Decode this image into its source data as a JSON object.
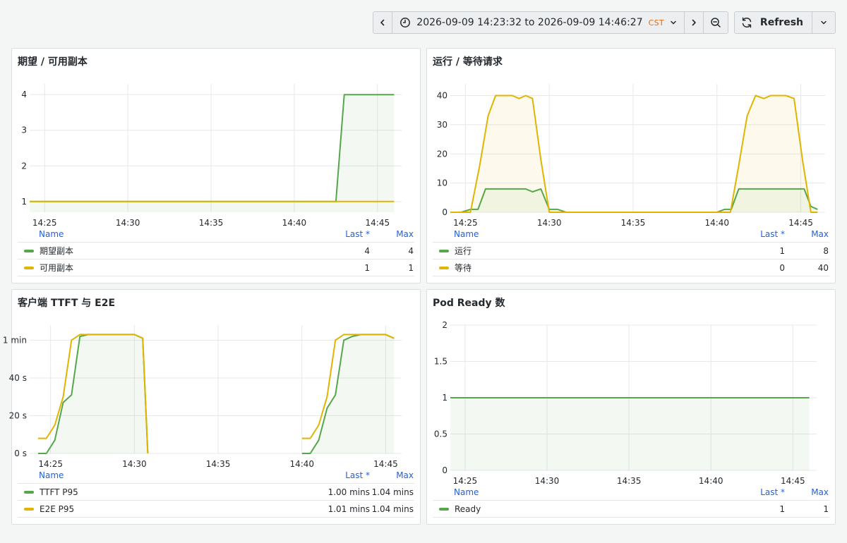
{
  "toolbar": {
    "time_range": "2026-09-09 14:23:32 to 2026-09-09 14:46:27",
    "timezone": "CST",
    "refresh_label": "Refresh"
  },
  "colors": {
    "green": "#56a64b",
    "yellow": "#e0b400",
    "green_fill": "rgba(86,166,75,0.08)",
    "yellow_fill": "rgba(224,180,0,0.08)"
  },
  "legend_header": {
    "name": "Name",
    "last": "Last *",
    "max": "Max"
  },
  "panels": [
    {
      "title": "期望 / 可用副本",
      "legend": [
        {
          "name": "期望副本",
          "last": "4",
          "max": "4",
          "color": "#56a64b"
        },
        {
          "name": "可用副本",
          "last": "1",
          "max": "1",
          "color": "#e0b400"
        }
      ]
    },
    {
      "title": "运行 / 等待请求",
      "legend": [
        {
          "name": "运行",
          "last": "1",
          "max": "8",
          "color": "#56a64b"
        },
        {
          "name": "等待",
          "last": "0",
          "max": "40",
          "color": "#e0b400"
        }
      ]
    },
    {
      "title": "客户端 TTFT 与 E2E",
      "legend": [
        {
          "name": "TTFT P95",
          "last": "1.00 mins",
          "max": "1.04 mins",
          "color": "#56a64b"
        },
        {
          "name": "E2E P95",
          "last": "1.01 mins",
          "max": "1.04 mins",
          "color": "#e0b400"
        }
      ]
    },
    {
      "title": "Pod Ready 数",
      "legend": [
        {
          "name": "Ready",
          "last": "1",
          "max": "1",
          "color": "#56a64b"
        }
      ]
    }
  ],
  "chart_data": [
    {
      "type": "line",
      "title": "期望 / 可用副本",
      "x_ticks": [
        "14:25",
        "14:30",
        "14:35",
        "14:40",
        "14:45"
      ],
      "y_ticks": [
        "1",
        "2",
        "3",
        "4"
      ],
      "ylim": [
        0.7,
        4.3
      ],
      "xlim": [
        24.1,
        46.45
      ],
      "grid": true,
      "fill_series": 0,
      "series": [
        {
          "name": "期望副本",
          "color": "#56a64b",
          "x": [
            24.1,
            42.5,
            43.0,
            46.0
          ],
          "y": [
            1,
            1,
            4,
            4
          ]
        },
        {
          "name": "可用副本",
          "color": "#e0b400",
          "x": [
            24.1,
            46.0
          ],
          "y": [
            1,
            1
          ]
        }
      ]
    },
    {
      "type": "line",
      "title": "运行 / 等待请求",
      "x_ticks": [
        "14:25",
        "14:30",
        "14:35",
        "14:40",
        "14:45"
      ],
      "y_ticks": [
        "0",
        "10",
        "20",
        "30",
        "40"
      ],
      "ylim": [
        0,
        44
      ],
      "xlim": [
        24.1,
        46.45
      ],
      "grid": true,
      "fill_series": "all",
      "series": [
        {
          "name": "运行",
          "color": "#56a64b",
          "x": [
            24.1,
            24.75,
            25.3,
            25.75,
            26.2,
            26.7,
            27.2,
            27.7,
            28.1,
            28.6,
            29.0,
            29.5,
            30.0,
            30.5,
            31.0,
            40.0,
            40.45,
            40.85,
            41.3,
            45.2,
            45.6,
            46.0
          ],
          "y": [
            0,
            0,
            1,
            1,
            8,
            8,
            8,
            8,
            8,
            8,
            7,
            8,
            1,
            1,
            0,
            0,
            1,
            1,
            8,
            8,
            2,
            1
          ]
        },
        {
          "name": "等待",
          "color": "#e0b400",
          "x": [
            24.1,
            25.3,
            25.85,
            26.35,
            26.8,
            27.3,
            27.8,
            28.2,
            28.6,
            29.0,
            29.5,
            30.0,
            31.0,
            40.0,
            40.8,
            41.3,
            41.8,
            42.3,
            42.8,
            43.2,
            43.6,
            44.1,
            44.6,
            45.1,
            45.6,
            46.0
          ],
          "y": [
            0,
            0,
            16,
            33,
            40,
            40,
            40,
            39,
            40,
            39,
            18,
            0,
            0,
            0,
            0,
            16,
            33,
            40,
            39,
            40,
            40,
            40,
            39,
            18,
            0,
            0
          ]
        }
      ]
    },
    {
      "type": "line",
      "title": "客户端 TTFT 与 E2E",
      "x_ticks": [
        "14:25",
        "14:30",
        "14:35",
        "14:40",
        "14:45"
      ],
      "y_ticks": [
        "0 s",
        "20 s",
        "40 s",
        "1 min"
      ],
      "ylim": [
        0,
        68
      ],
      "xlim": [
        23.75,
        45.95
      ],
      "grid": true,
      "fill_series": 0,
      "series": [
        {
          "name": "TTFT P95",
          "color": "#56a64b",
          "x": [
            24.25,
            24.75,
            25.25,
            25.75,
            26.25,
            26.75,
            27.25,
            27.75,
            28.25,
            28.75,
            29.25,
            30.0,
            30.5,
            30.8
          ],
          "y": [
            0,
            0,
            7,
            27,
            31,
            62,
            63,
            63,
            63,
            63,
            63,
            63,
            61,
            0
          ]
        },
        {
          "name": "E2E P95",
          "color": "#e0b400",
          "x": [
            24.25,
            24.75,
            25.25,
            25.75,
            26.25,
            26.75,
            27.25,
            27.75,
            28.25,
            28.75,
            29.25,
            30.0,
            30.5,
            30.8
          ],
          "y": [
            8,
            8,
            15,
            30,
            60,
            63,
            63,
            63,
            63,
            63,
            63,
            63,
            61,
            0
          ]
        },
        {
          "name": "TTFT P95",
          "color": "#56a64b",
          "x": [
            40.0,
            40.5,
            41.0,
            41.5,
            42.0,
            42.5,
            43.0,
            43.5,
            44.0,
            44.5,
            45.0,
            45.5
          ],
          "y": [
            0,
            0,
            7,
            24,
            31,
            60,
            62,
            63,
            63,
            63,
            63,
            61
          ]
        },
        {
          "name": "E2E P95",
          "color": "#e0b400",
          "x": [
            40.0,
            40.5,
            41.0,
            41.5,
            42.0,
            42.5,
            43.0,
            43.5,
            44.0,
            44.5,
            45.0,
            45.5
          ],
          "y": [
            8,
            8,
            15,
            30,
            60,
            63,
            63,
            63,
            63,
            63,
            63,
            61
          ]
        }
      ]
    },
    {
      "type": "line",
      "title": "Pod Ready 数",
      "x_ticks": [
        "14:25",
        "14:30",
        "14:35",
        "14:40",
        "14:45"
      ],
      "y_ticks": [
        "0",
        "0.5",
        "1",
        "1.5",
        "2"
      ],
      "ylim": [
        0,
        2
      ],
      "xlim": [
        24.1,
        46.45
      ],
      "grid": true,
      "fill_series": 0,
      "series": [
        {
          "name": "Ready",
          "color": "#56a64b",
          "x": [
            24.1,
            46.0
          ],
          "y": [
            1,
            1
          ]
        }
      ]
    }
  ]
}
